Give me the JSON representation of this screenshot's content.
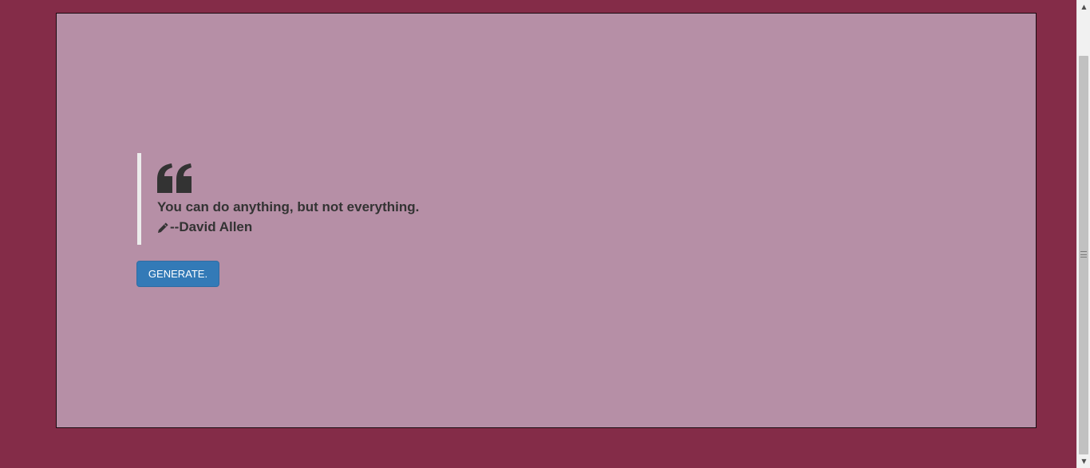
{
  "quote": {
    "text": "You can do anything, but not everything.",
    "author": "--David Allen",
    "quote_icon": "left-quote-icon",
    "author_icon": "pencil-icon"
  },
  "actions": {
    "generate_label": "GENERATE."
  },
  "scrollbar": {
    "up_arrow": "▲",
    "down_arrow": "▼"
  },
  "colors": {
    "page_background": "#842c48",
    "panel_background": "#b68fa6",
    "button_primary": "#337ab7",
    "text": "#333333",
    "quote_border": "#ececec"
  }
}
